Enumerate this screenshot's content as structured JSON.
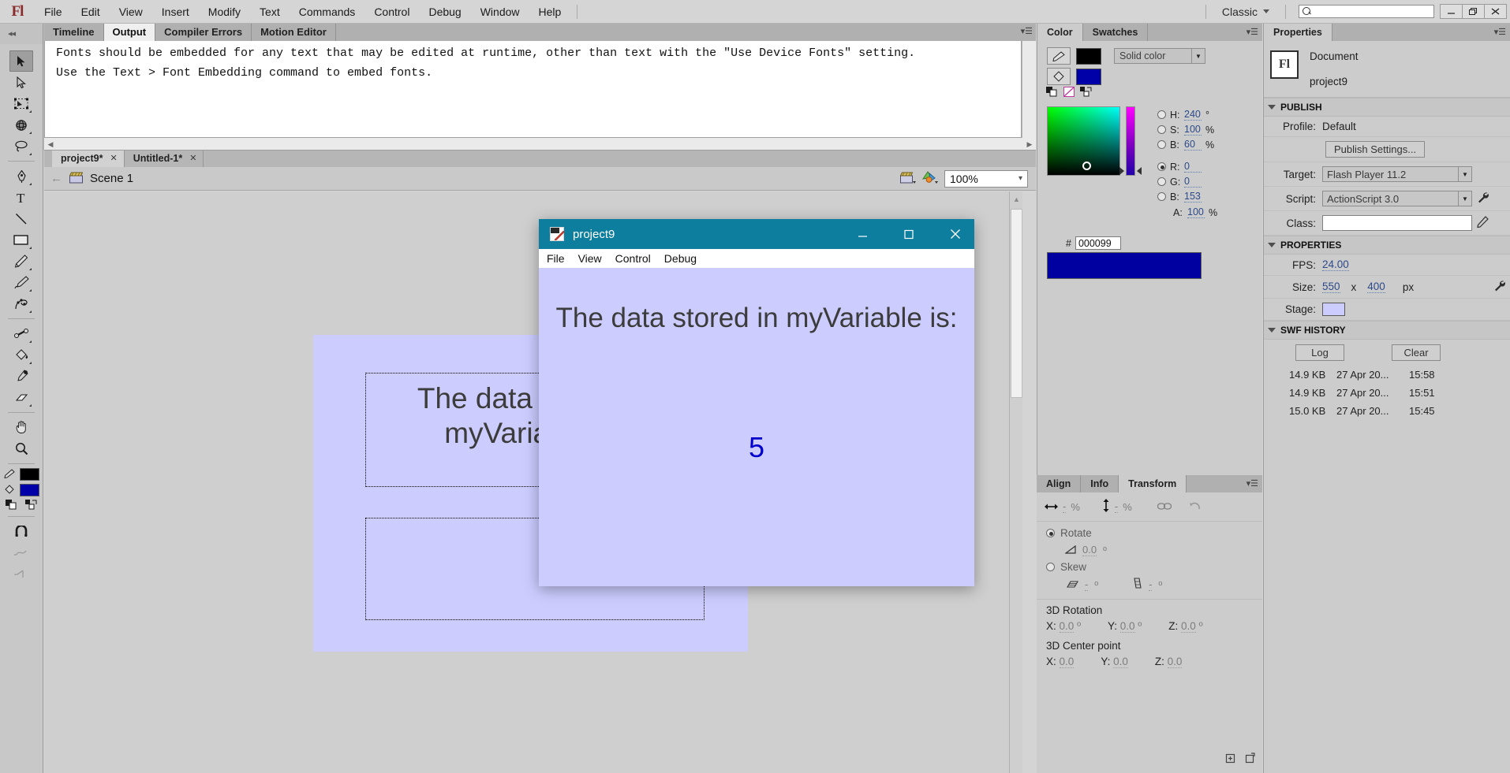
{
  "menubar": {
    "logo": "Fl",
    "items": [
      "File",
      "Edit",
      "View",
      "Insert",
      "Modify",
      "Text",
      "Commands",
      "Control",
      "Debug",
      "Window",
      "Help"
    ],
    "workspace": "Classic",
    "search_placeholder": "",
    "search_value": "",
    "window_buttons": [
      "minimize",
      "restore",
      "close"
    ]
  },
  "output_dock": {
    "tabs": [
      "Timeline",
      "Output",
      "Compiler Errors",
      "Motion Editor"
    ],
    "active_tab": "Output",
    "text_line1": "Fonts should be embedded for any text that may be edited at runtime, other than text with the \"Use Device Fonts\" setting.",
    "text_line2": "Use the Text > Font Embedding command to embed fonts."
  },
  "toolbar": {
    "tools": [
      {
        "name": "selection-tool",
        "selected": true
      },
      {
        "name": "subselection-tool",
        "selected": false
      },
      {
        "name": "free-transform-tool",
        "selected": false
      },
      {
        "name": "3d-rotation-tool",
        "selected": false
      },
      {
        "name": "lasso-tool",
        "selected": false
      },
      {
        "name": "pen-tool",
        "selected": false
      },
      {
        "name": "text-tool",
        "selected": false
      },
      {
        "name": "line-tool",
        "selected": false
      },
      {
        "name": "rectangle-tool",
        "selected": false
      },
      {
        "name": "pencil-tool",
        "selected": false
      },
      {
        "name": "brush-tool",
        "selected": false
      },
      {
        "name": "deco-tool",
        "selected": false
      },
      {
        "name": "bone-tool",
        "selected": false
      },
      {
        "name": "paint-bucket-tool",
        "selected": false
      },
      {
        "name": "eyedropper-tool",
        "selected": false
      },
      {
        "name": "eraser-tool",
        "selected": false
      },
      {
        "name": "hand-tool",
        "selected": false
      },
      {
        "name": "zoom-tool",
        "selected": false
      }
    ],
    "stroke_color": "#000000",
    "fill_color": "#0000a8"
  },
  "document_tabs": [
    {
      "label": "project9*",
      "active": true
    },
    {
      "label": "Untitled-1*",
      "active": false
    }
  ],
  "scene_bar": {
    "scene_label": "Scene 1",
    "zoom": "100%"
  },
  "stage": {
    "background": "#ccccff",
    "text_field_1": "The data stored in myVariable is:",
    "text_field_2": ""
  },
  "color_panel": {
    "tabs": [
      "Color",
      "Swatches"
    ],
    "active_tab": "Color",
    "fill_type": "Solid color",
    "hex_label": "#",
    "hex_value": "000099",
    "channels": [
      {
        "label": "H:",
        "value": "240",
        "unit": "°",
        "selected": false
      },
      {
        "label": "S:",
        "value": "100",
        "unit": "%",
        "selected": false
      },
      {
        "label": "B:",
        "value": "60",
        "unit": "%",
        "selected": false
      },
      {
        "label": "R:",
        "value": "0",
        "unit": "",
        "selected": true
      },
      {
        "label": "G:",
        "value": "0",
        "unit": "",
        "selected": false
      },
      {
        "label": "B:",
        "value": "153",
        "unit": "",
        "selected": false
      },
      {
        "label": "A:",
        "value": "100",
        "unit": "%",
        "selected": false
      }
    ],
    "preview_color": "#0000a0",
    "stroke_swatch": "#000000",
    "fill_swatch": "#0000a8"
  },
  "transform_panel": {
    "tabs": [
      "Align",
      "Info",
      "Transform"
    ],
    "active_tab": "Transform",
    "scale_w": "-",
    "scale_w_unit": "%",
    "scale_h": "-",
    "scale_h_unit": "%",
    "rotate_label": "Rotate",
    "rotate_value": "0.0",
    "rotate_unit": "º",
    "skew_label": "Skew",
    "skew_h": "-",
    "skew_v": "-",
    "skew_unit": "º",
    "rotation_3d_title": "3D Rotation",
    "rotation_3d": {
      "x": "0.0",
      "y": "0.0",
      "z": "0.0",
      "unit": "º"
    },
    "center_3d_title": "3D Center point",
    "center_3d": {
      "x": "0.0",
      "y": "0.0",
      "z": "0.0"
    },
    "axis_labels": {
      "x": "X:",
      "y": "Y:",
      "z": "Z:"
    }
  },
  "properties_panel": {
    "tab_label": "Properties",
    "doc_type": "Document",
    "doc_name": "project9",
    "icon_text": "Fl",
    "publish_section": "PUBLISH",
    "profile_label": "Profile:",
    "profile_value": "Default",
    "publish_settings_button": "Publish Settings...",
    "target_label": "Target:",
    "target_value": "Flash Player 11.2",
    "script_label": "Script:",
    "script_value": "ActionScript 3.0",
    "class_label": "Class:",
    "class_value": "",
    "properties_section": "PROPERTIES",
    "fps_label": "FPS:",
    "fps_value": "24.00",
    "size_label": "Size:",
    "size_w": "550",
    "size_x": "x",
    "size_h": "400",
    "size_unit": "px",
    "stage_label": "Stage:",
    "stage_color": "#ccccff",
    "swf_history_section": "SWF HISTORY",
    "log_button": "Log",
    "clear_button": "Clear",
    "swf_history": [
      {
        "size": "14.9 KB",
        "date": "27 Apr 20...",
        "time": "15:58"
      },
      {
        "size": "14.9 KB",
        "date": "27 Apr 20...",
        "time": "15:51"
      },
      {
        "size": "15.0 KB",
        "date": "27 Apr 20...",
        "time": "15:45"
      }
    ]
  },
  "flash_player": {
    "title": "project9",
    "menu": [
      "File",
      "View",
      "Control",
      "Debug"
    ],
    "titlebar_color": "#0e7e9e",
    "stage_color": "#ccccff",
    "text": "The data stored in myVariable is:",
    "value": "5",
    "value_color": "#0000cc",
    "window_buttons": [
      "minimize",
      "maximize",
      "close"
    ]
  }
}
